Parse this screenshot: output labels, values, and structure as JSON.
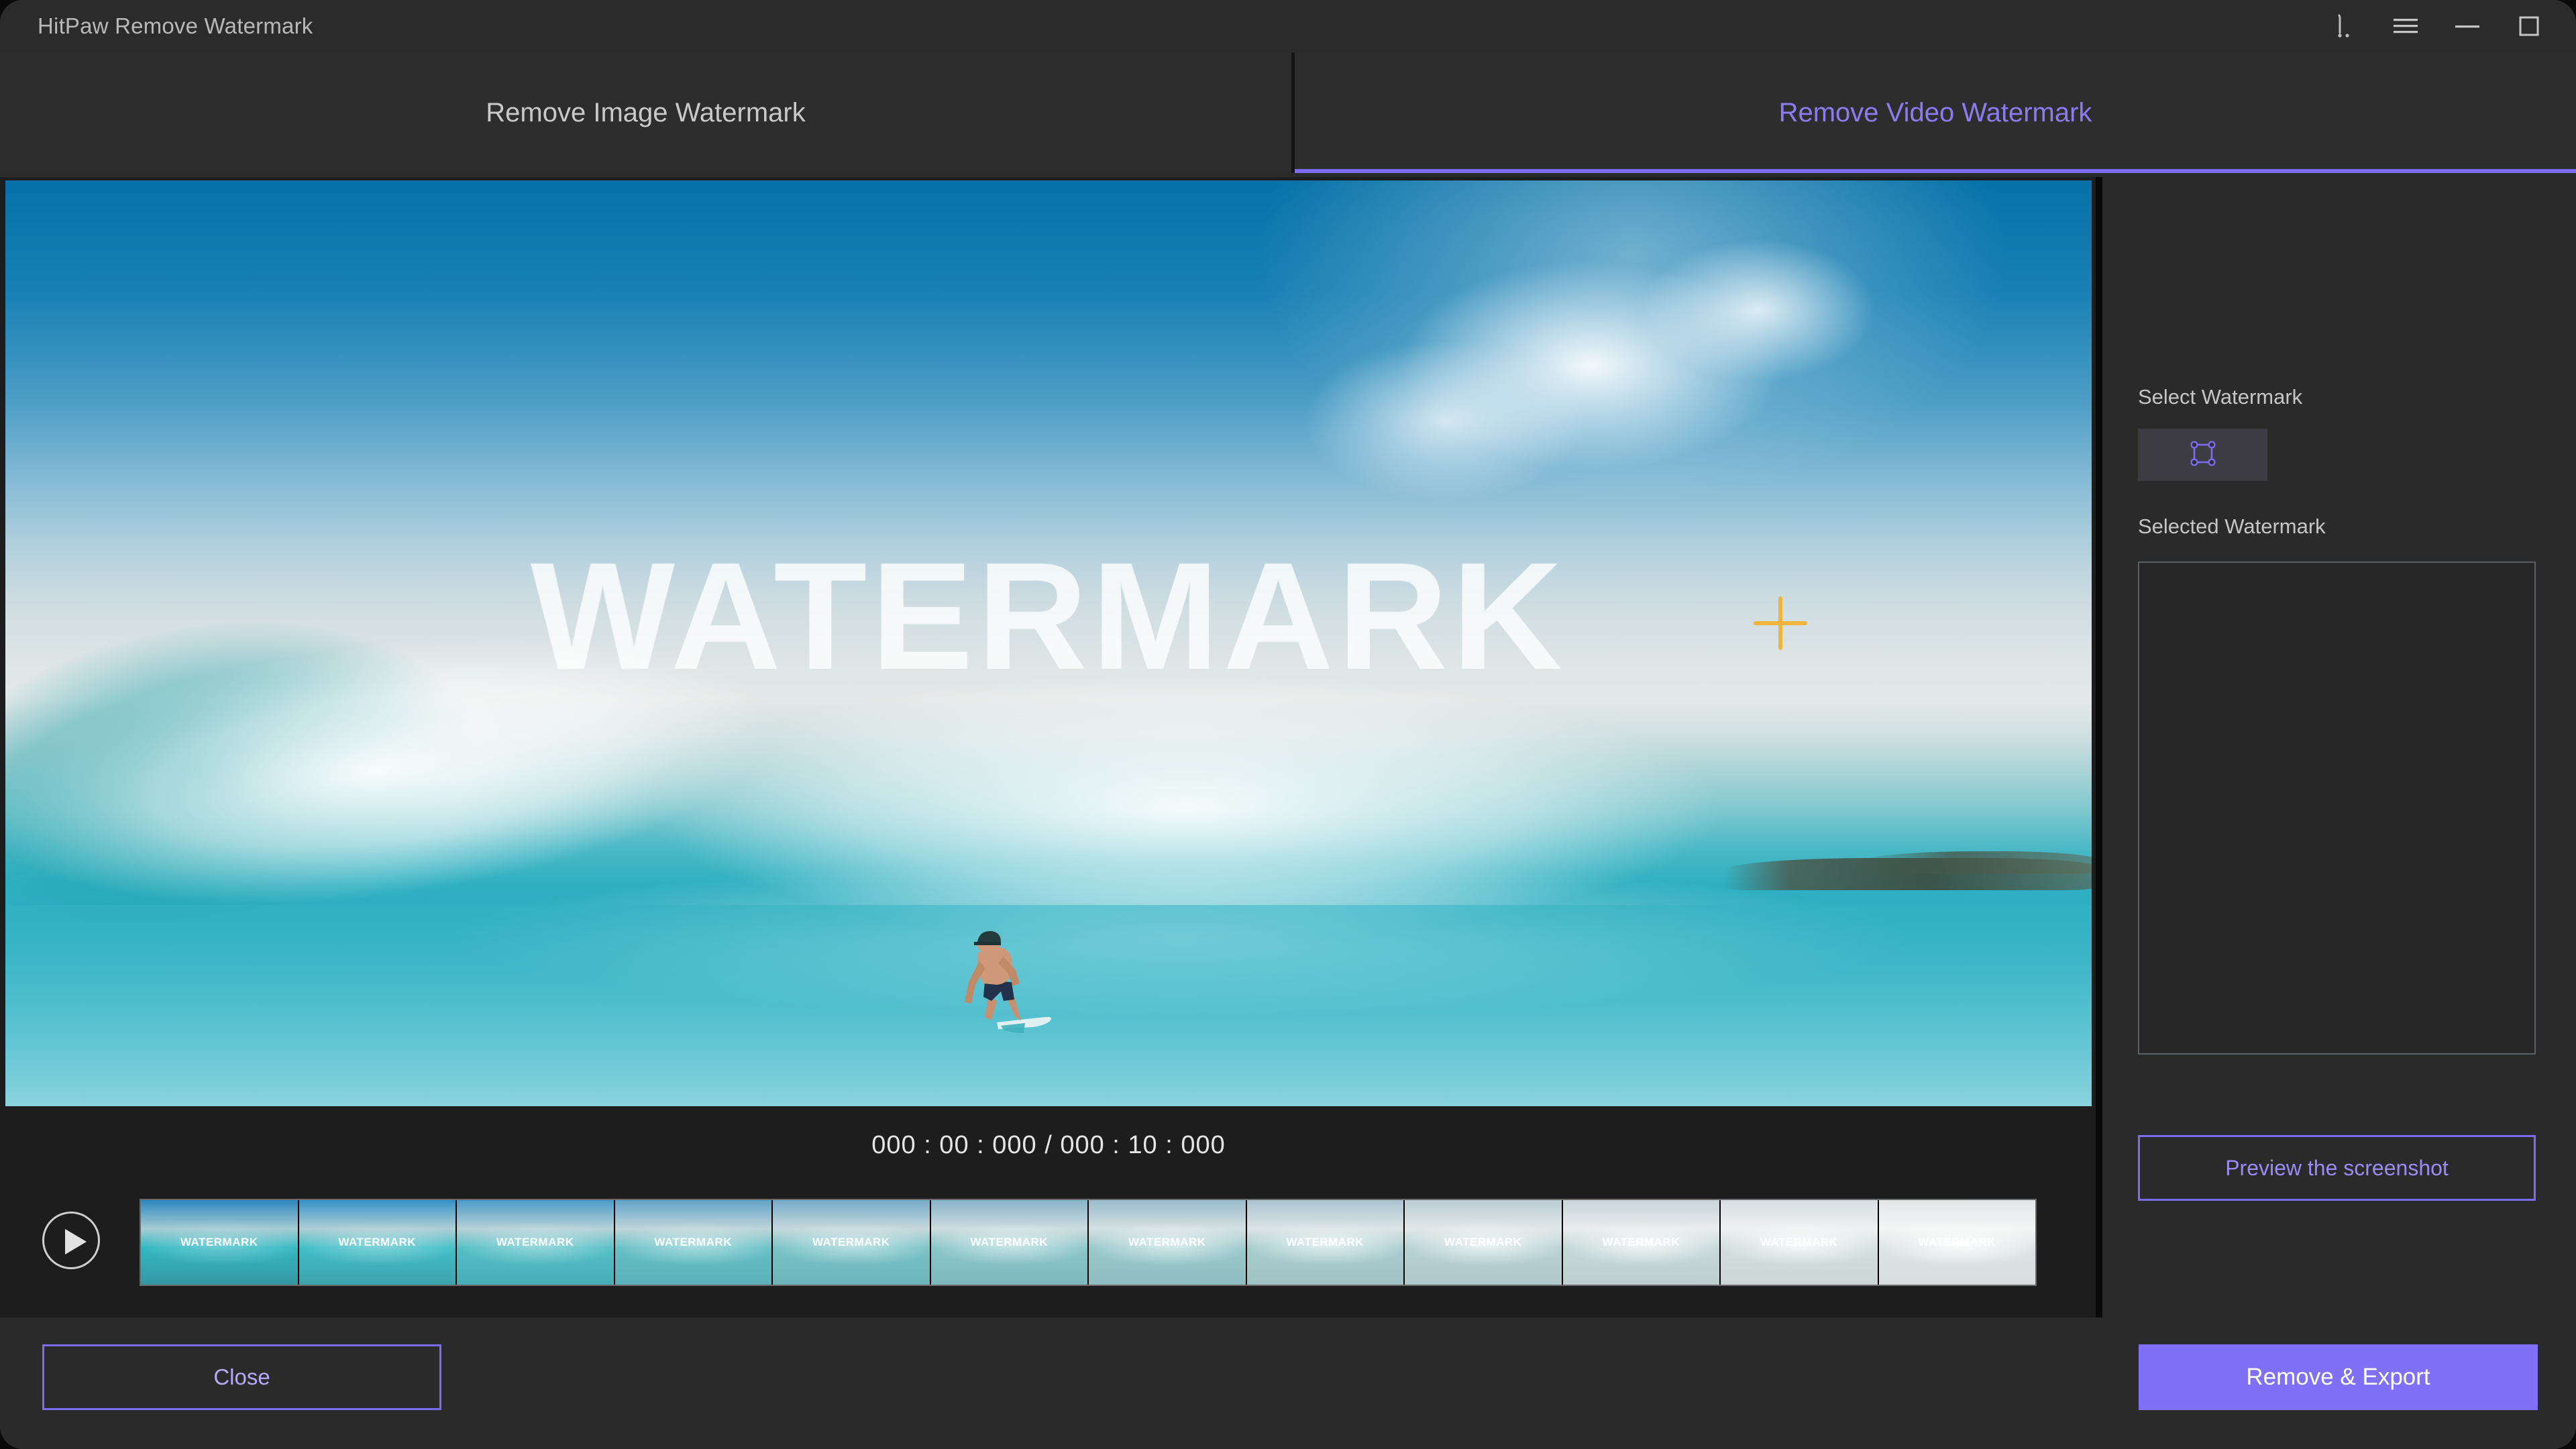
{
  "window": {
    "title": "HitPaw Remove Watermark",
    "controls": [
      {
        "name": "pin-icon",
        "label": ""
      },
      {
        "name": "hamburger-menu-icon",
        "label": ""
      },
      {
        "name": "minimize-icon",
        "label": ""
      },
      {
        "name": "maximize-icon",
        "label": ""
      }
    ]
  },
  "tabs": [
    {
      "label": "Remove Image Watermark",
      "active": false
    },
    {
      "label": "Remove Video Watermark",
      "active": true
    }
  ],
  "editor": {
    "video_watermark_text": "WATERMARK",
    "timecode": "000 : 00 : 000 / 000 : 10 : 000",
    "current_time": "000 : 00 : 000",
    "total_time": "000 : 10 : 000",
    "play_button_label": "",
    "filmstrip": {
      "thumbnail_label": "WATERMARK",
      "thumbnails": [
        "WATERMARK",
        "WATERMARK",
        "WATERMARK",
        "WATERMARK",
        "WATERMARK",
        "WATERMARK",
        "WATERMARK",
        "WATERMARK",
        "WATERMARK",
        "WATERMARK",
        "WATERMARK",
        "WATERMARK"
      ]
    }
  },
  "sidebar": {
    "select_watermark_label": "Select Watermark",
    "selected_watermark_label": "Selected Watermark",
    "tool_icon_name": "selection-box-icon",
    "selected_watermark_items": [],
    "preview_button_label": "Preview the screenshot"
  },
  "footer": {
    "close_label": "Close",
    "remove_export_label": "Remove & Export"
  },
  "colors": {
    "accent_purple": "#7d6cf0",
    "accent_purple_text": "#8c7cf0",
    "button_fill": "#8070f8",
    "window_bg": "#2a2a2a",
    "panel_bg": "#1d1d1d",
    "tab_bg": "#2d2d2d",
    "crosshair": "#f0b43c"
  }
}
